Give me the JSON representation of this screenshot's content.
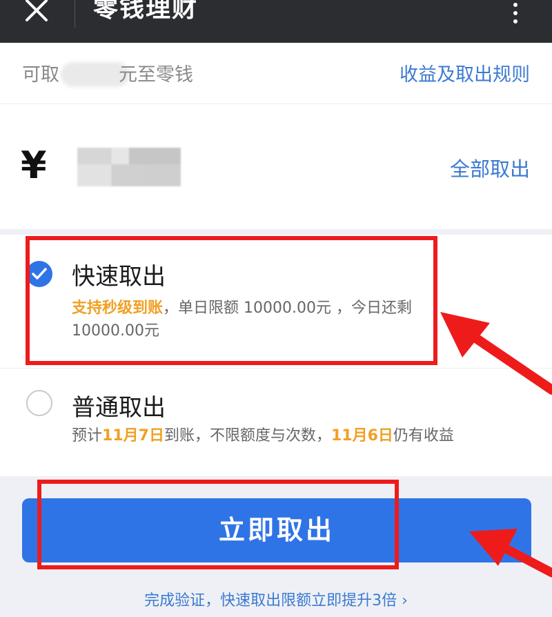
{
  "topbar": {
    "title": "零钱理财",
    "close_icon": "close-icon",
    "more_icon": "more-vertical-icon"
  },
  "available": {
    "prefix": "可取",
    "suffix": "元至零钱",
    "rules_link": "收益及取出规则"
  },
  "amount": {
    "currency_symbol": "¥",
    "withdraw_all": "全部取出"
  },
  "options": {
    "fast": {
      "title": "快速取出",
      "checked": true,
      "desc_highlight": "支持秒级到账",
      "desc_rest": "，单日限额 10000.00元 ，今日还剩10000.00元"
    },
    "normal": {
      "title": "普通取出",
      "checked": false,
      "desc_1": "预计",
      "desc_date1": "11月7日",
      "desc_2": "到账，不限额度与次数，",
      "desc_date2": "11月6日",
      "desc_3": "仍有收益"
    }
  },
  "submit_button": "立即取出",
  "footer_tip": "完成验证，快速取出限额立即提升3倍 ›",
  "colors": {
    "accent_blue": "#2f74e6",
    "link_blue": "#3b7ad1",
    "highlight_orange": "#f0a023",
    "annotation_red": "#ee1b1b",
    "topbar_bg": "#2b2d31"
  }
}
